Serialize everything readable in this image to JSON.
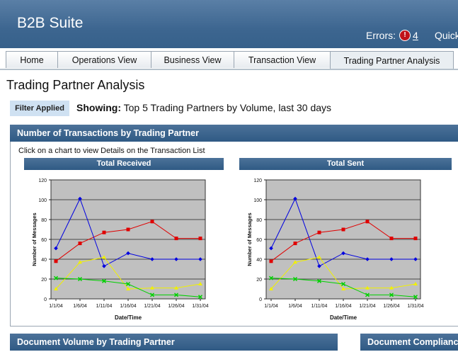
{
  "header": {
    "app_title": "B2B Suite",
    "errors_label": "Errors:",
    "errors_count": "4",
    "quick_label": "Quick"
  },
  "tabs": [
    {
      "label": "Home"
    },
    {
      "label": "Operations View"
    },
    {
      "label": "Business View"
    },
    {
      "label": "Transaction View"
    },
    {
      "label": "Trading Partner Analysis",
      "active": true
    }
  ],
  "page": {
    "title": "Trading Partner Analysis",
    "filter_badge": "Filter Applied",
    "showing_label": "Showing:",
    "showing_text": "Top 5 Trading Partners by Volume, last 30 days"
  },
  "transactions_panel": {
    "title": "Number of Transactions by Trading Partner",
    "hint": "Click on a chart to view Details on the Transaction List"
  },
  "bottom_panels": [
    {
      "title": "Document Volume by Trading Partner"
    },
    {
      "title": "Document Compliance"
    }
  ],
  "colors": {
    "header_bg": "#3d6690",
    "plot_bg": "#c0c0c0",
    "filter_badge_bg": "#cfe1f2"
  },
  "chart_data": [
    {
      "type": "line",
      "title": "Total Received",
      "xlabel": "Date/Time",
      "ylabel": "Number of Messages",
      "x": [
        "1/1/04",
        "1/6/04",
        "1/11/04",
        "1/16/04",
        "1/21/04",
        "1/26/04",
        "1/31/04"
      ],
      "ylim": [
        0,
        120
      ],
      "yticks": [
        0,
        20,
        40,
        60,
        80,
        100,
        120
      ],
      "grid": true,
      "series": [
        {
          "color": "#e00000",
          "marker": "square",
          "values": [
            [
              0,
              38
            ],
            [
              1,
              56
            ],
            [
              2,
              67
            ],
            [
              3,
              70
            ],
            [
              4,
              78
            ],
            [
              5,
              61
            ],
            [
              6,
              61
            ]
          ]
        },
        {
          "color": "#0000e0",
          "marker": "diamond",
          "values": [
            [
              0,
              51
            ],
            [
              1,
              101
            ],
            [
              2,
              33
            ],
            [
              3,
              46
            ],
            [
              4,
              40
            ],
            [
              5,
              40
            ],
            [
              6,
              40
            ]
          ]
        },
        {
          "color": "#f0f000",
          "marker": "triangle",
          "values": [
            [
              0,
              10
            ],
            [
              1,
              37
            ],
            [
              2,
              42
            ],
            [
              3,
              10
            ],
            [
              4,
              11
            ],
            [
              5,
              11
            ],
            [
              6,
              15
            ]
          ]
        },
        {
          "color": "#00d000",
          "marker": "x",
          "values": [
            [
              0,
              21
            ],
            [
              1,
              20
            ],
            [
              2,
              18
            ],
            [
              3,
              15
            ],
            [
              4,
              4
            ],
            [
              5,
              4
            ],
            [
              6,
              2
            ]
          ]
        }
      ]
    },
    {
      "type": "line",
      "title": "Total Sent",
      "xlabel": "Date/Time",
      "ylabel": "Number of Messages",
      "x": [
        "1/1/04",
        "1/6/04",
        "1/11/04",
        "1/16/04",
        "1/21/04",
        "1/26/04",
        "1/31/04"
      ],
      "ylim": [
        0,
        120
      ],
      "yticks": [
        0,
        20,
        40,
        60,
        80,
        100,
        120
      ],
      "grid": true,
      "series": [
        {
          "color": "#e00000",
          "marker": "square",
          "values": [
            [
              0,
              38
            ],
            [
              1,
              56
            ],
            [
              2,
              67
            ],
            [
              3,
              70
            ],
            [
              4,
              78
            ],
            [
              5,
              61
            ],
            [
              6,
              61
            ]
          ]
        },
        {
          "color": "#0000e0",
          "marker": "diamond",
          "values": [
            [
              0,
              51
            ],
            [
              1,
              101
            ],
            [
              2,
              33
            ],
            [
              3,
              46
            ],
            [
              4,
              40
            ],
            [
              5,
              40
            ],
            [
              6,
              40
            ]
          ]
        },
        {
          "color": "#f0f000",
          "marker": "triangle",
          "values": [
            [
              0,
              10
            ],
            [
              1,
              37
            ],
            [
              2,
              42
            ],
            [
              3,
              10
            ],
            [
              4,
              11
            ],
            [
              5,
              11
            ],
            [
              6,
              15
            ]
          ]
        },
        {
          "color": "#00d000",
          "marker": "x",
          "values": [
            [
              0,
              21
            ],
            [
              1,
              20
            ],
            [
              2,
              18
            ],
            [
              3,
              15
            ],
            [
              4,
              4
            ],
            [
              5,
              4
            ],
            [
              6,
              2
            ]
          ]
        }
      ]
    }
  ]
}
